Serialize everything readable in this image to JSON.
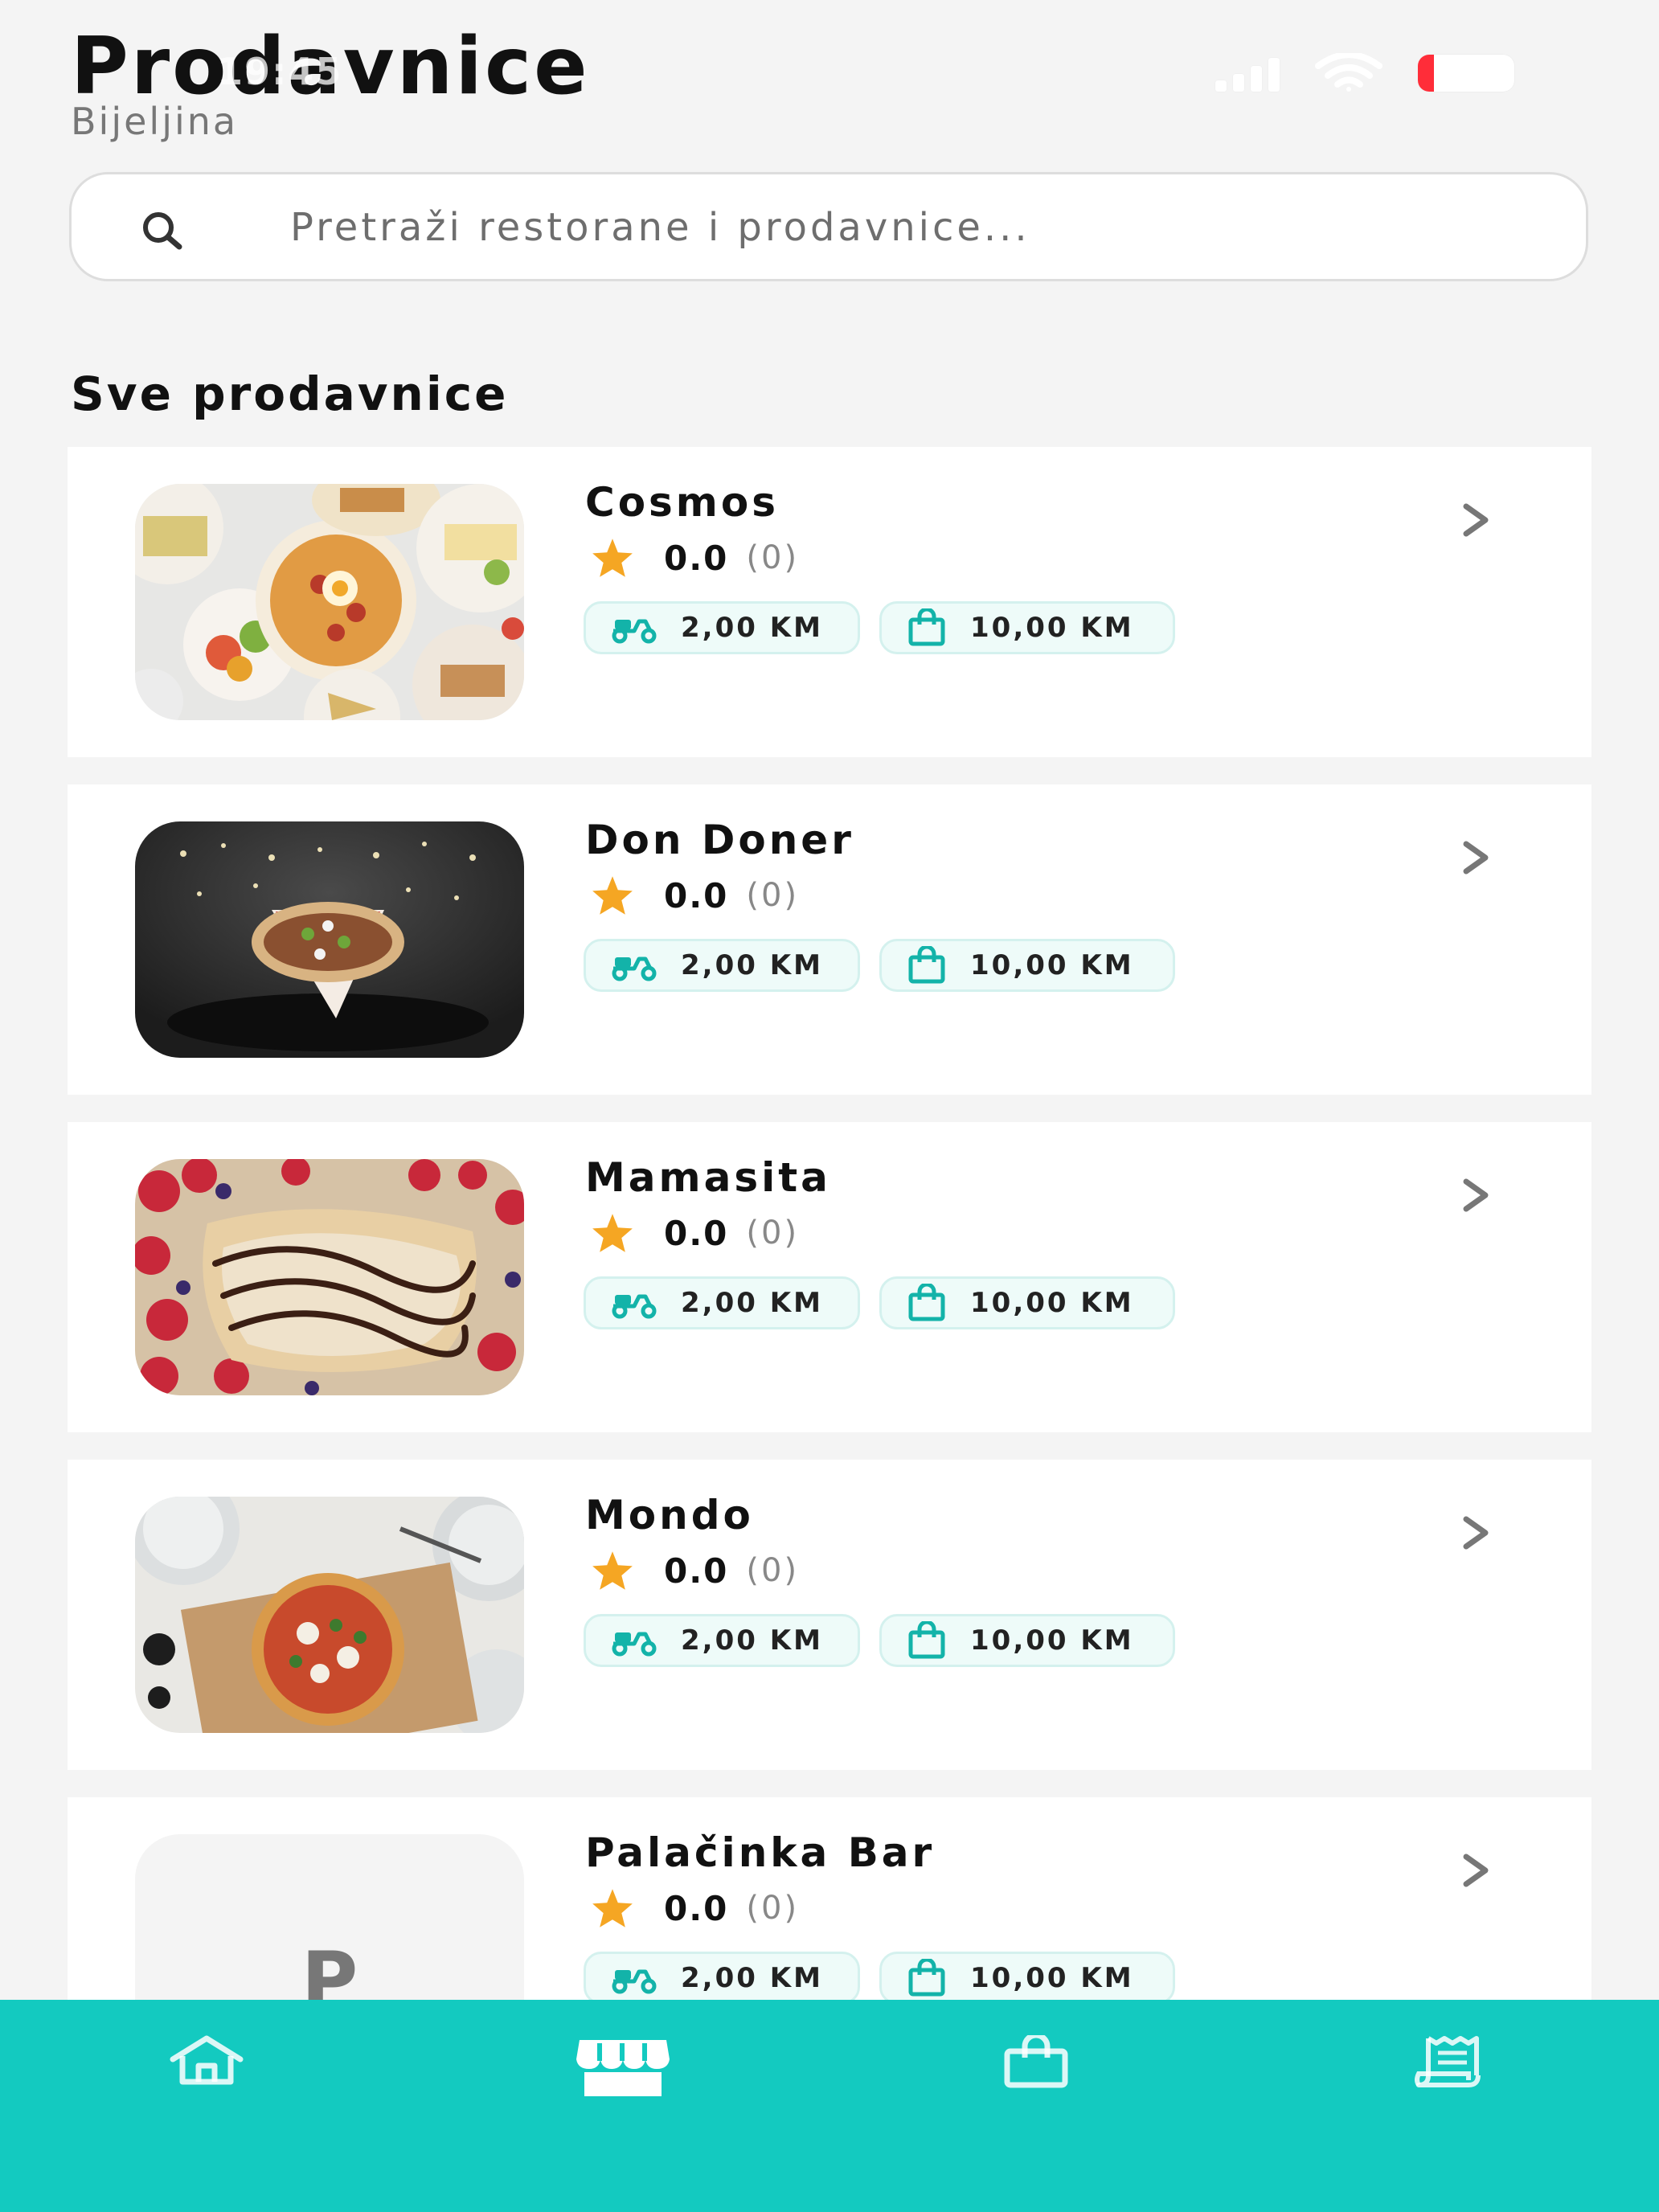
{
  "status_bar": {
    "time": "19:45",
    "battery_percent": 15,
    "battery_label": "15"
  },
  "header": {
    "title": "Prodavnice",
    "city": "Bijeljina"
  },
  "search": {
    "placeholder": "Pretraži restorane i prodavnice..."
  },
  "section": {
    "title": "Sve prodavnice"
  },
  "stores": [
    {
      "name": "Cosmos",
      "rating": "0.0",
      "reviews": "(0)",
      "delivery_fee": "2,00 KM",
      "min_order": "10,00 KM",
      "image": "food-platter-photo"
    },
    {
      "name": "Don Doner",
      "rating": "0.0",
      "reviews": "(0)",
      "delivery_fee": "2,00 KM",
      "min_order": "10,00 KM",
      "image": "doner-wrap-photo"
    },
    {
      "name": "Mamasita",
      "rating": "0.0",
      "reviews": "(0)",
      "delivery_fee": "2,00 KM",
      "min_order": "10,00 KM",
      "image": "crepes-photo"
    },
    {
      "name": "Mondo",
      "rating": "0.0",
      "reviews": "(0)",
      "delivery_fee": "2,00 KM",
      "min_order": "10,00 KM",
      "image": "pizza-photo"
    },
    {
      "name": "Palačinka Bar",
      "rating": "0.0",
      "reviews": "(0)",
      "delivery_fee": "2,00 KM",
      "min_order": "10,00 KM",
      "placeholder_letter": "P"
    }
  ],
  "bottom_nav": [
    {
      "icon": "home-icon",
      "active": false
    },
    {
      "icon": "store-icon",
      "active": true
    },
    {
      "icon": "shopping-bag-icon",
      "active": false
    },
    {
      "icon": "receipt-icon",
      "active": false
    }
  ],
  "colors": {
    "accent": "#13cac0",
    "star": "#f5a623",
    "chip_bg": "#eefbf9",
    "background": "#f4f4f4"
  }
}
